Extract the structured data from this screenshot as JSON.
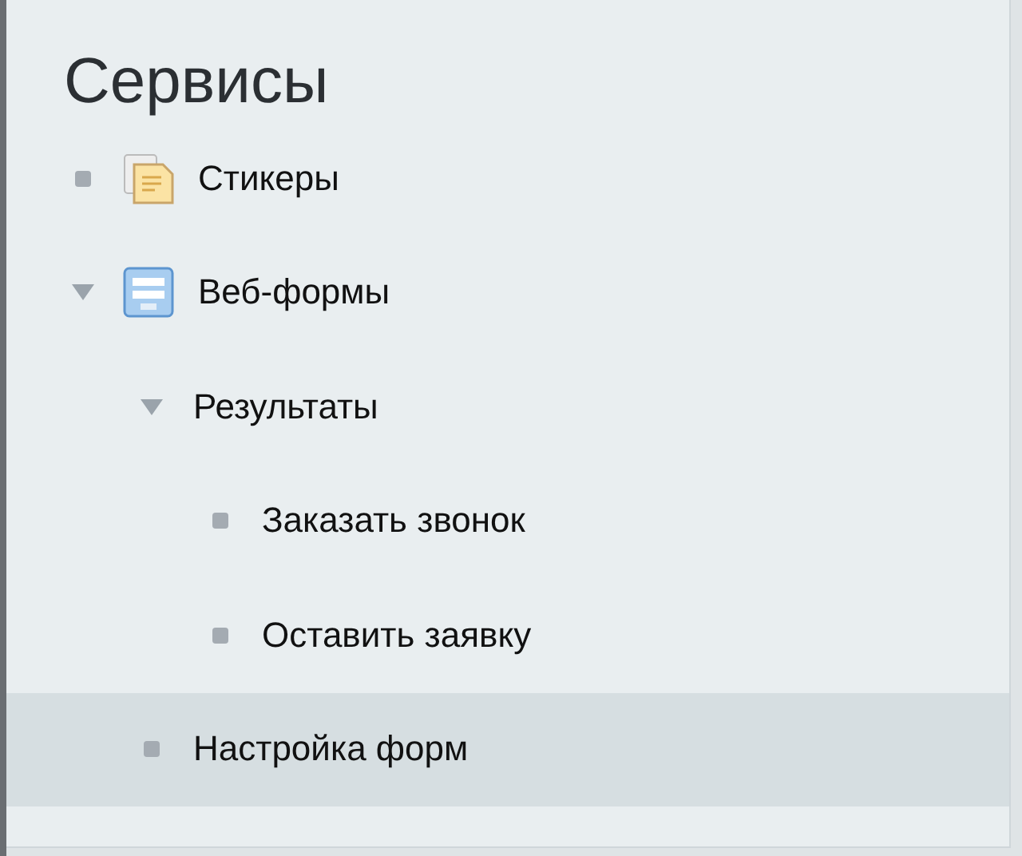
{
  "title": "Сервисы",
  "items": [
    {
      "label": "Стикеры",
      "kind": "sticker",
      "selected": false
    },
    {
      "label": "Веб-формы",
      "kind": "form",
      "selected": false,
      "expanded": true,
      "children": [
        {
          "label": "Результаты",
          "selected": false,
          "expanded": true,
          "children": [
            {
              "label": "Заказать звонок",
              "selected": false
            },
            {
              "label": "Оставить заявку",
              "selected": false
            }
          ]
        },
        {
          "label": "Настройка форм",
          "selected": true
        }
      ]
    }
  ]
}
